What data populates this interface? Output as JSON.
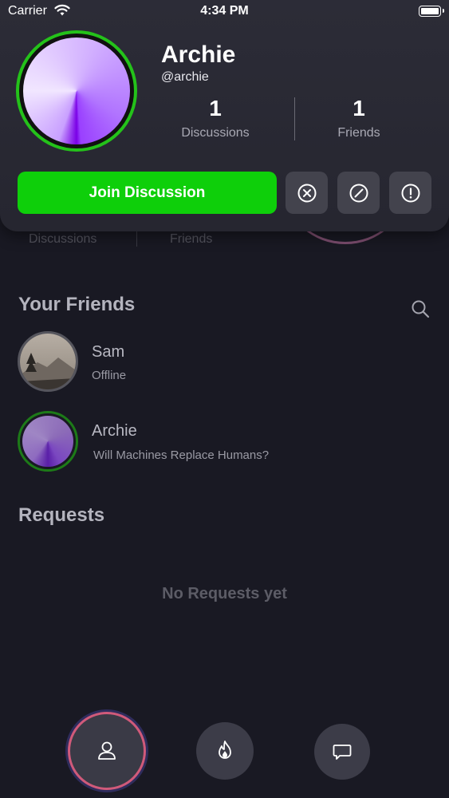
{
  "status_bar": {
    "carrier": "Carrier",
    "time": "4:34 PM"
  },
  "profile": {
    "name": "Archie",
    "handle": "@archie",
    "discussions_count": "1",
    "discussions_label": "Discussions",
    "friends_count": "1",
    "friends_label": "Friends",
    "join_button_label": "Join Discussion",
    "accent_color": "#0ecf0a",
    "ring_color": "#24c21a"
  },
  "background": {
    "discussions_label": "Discussions",
    "friends_label": "Friends"
  },
  "friends_section": {
    "title": "Your Friends",
    "friends": [
      {
        "name": "Sam",
        "status": "Offline"
      },
      {
        "name": "Archie",
        "status": "Will Machines Replace Humans?"
      }
    ]
  },
  "requests_section": {
    "title": "Requests",
    "empty_message": "No Requests yet"
  },
  "tab_bar": {
    "tabs": [
      {
        "icon": "person-icon",
        "active": true
      },
      {
        "icon": "flame-icon",
        "active": false
      },
      {
        "icon": "chat-bubble-icon",
        "active": false
      }
    ]
  }
}
